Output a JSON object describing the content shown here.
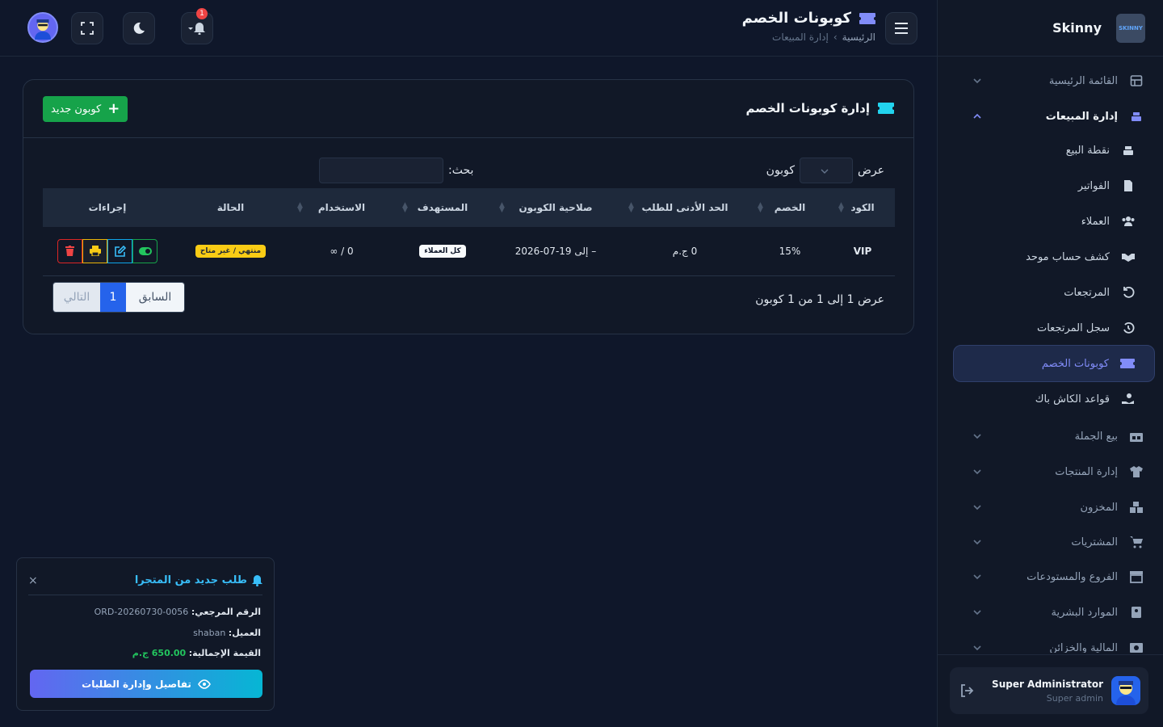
{
  "brand": {
    "name": "Skinny",
    "logo_text": "SKINNY"
  },
  "sidebar": {
    "items": [
      {
        "label": "القائمة الرئيسية",
        "icon": "grid-icon"
      },
      {
        "label": "إدارة المبيعات",
        "icon": "cash-register-icon"
      },
      {
        "label": "نقطة البيع",
        "icon": "cash-register-icon"
      },
      {
        "label": "الفواتير",
        "icon": "invoice-icon"
      },
      {
        "label": "العملاء",
        "icon": "users-icon"
      },
      {
        "label": "كشف حساب موحد",
        "icon": "handshake-icon"
      },
      {
        "label": "المرتجعات",
        "icon": "undo-icon"
      },
      {
        "label": "سجل المرتجعات",
        "icon": "history-icon"
      },
      {
        "label": "كوبونات الخصم",
        "icon": "ticket-icon"
      },
      {
        "label": "قواعد الكاش باك",
        "icon": "hand-coin-icon"
      },
      {
        "label": "بيع الجملة",
        "icon": "warehouse-icon"
      },
      {
        "label": "إدارة المنتجات",
        "icon": "shirt-icon"
      },
      {
        "label": "المخزون",
        "icon": "boxes-icon"
      },
      {
        "label": "المشتريات",
        "icon": "cart-icon"
      },
      {
        "label": "الفروع والمستودعات",
        "icon": "store-icon"
      },
      {
        "label": "الموارد البشرية",
        "icon": "id-badge-icon"
      },
      {
        "label": "المالية والخزائن",
        "icon": "money-icon"
      }
    ],
    "user": {
      "name": "Super Administrator",
      "role": "Super admin"
    }
  },
  "header": {
    "title": "كوبونات الخصم",
    "breadcrumb": {
      "home": "الرئيسية",
      "separator": "›",
      "current": "إدارة المبيعات"
    },
    "notification_count": "1"
  },
  "card": {
    "title": "إدارة كوبونات الخصم",
    "new_button": "كوبون جديد",
    "length_prefix": "عرض",
    "length_suffix": "كوبون",
    "search_label": "بحث:",
    "search_placeholder": ""
  },
  "table": {
    "headers": [
      "الكود",
      "الخصم",
      "الحد الأدنى للطلب",
      "صلاحية الكوبون",
      "المستهدف",
      "الاستخدام",
      "الحالة",
      "إجراءات"
    ],
    "rows": [
      {
        "code": "VIP",
        "discount": "15%",
        "min_order": "0 ج.م",
        "validity": "– إلى 19-07-2026",
        "target": "كل العملاء",
        "usage": "0 / ∞",
        "status": "منتهي / غير متاح"
      }
    ],
    "info": "عرض 1 إلى 1 من 1 كوبون",
    "pager": {
      "prev": "السابق",
      "page": "1",
      "next": "التالي"
    }
  },
  "toast": {
    "title": "طلب جديد من المتجرا",
    "ref_label": "الرقم المرجعي:",
    "ref_value": "ORD-20260730-0056",
    "customer_label": "العميل:",
    "customer_value": "shaban",
    "total_label": "القيمة الإجمالية:",
    "total_value": "650.00 ج.م",
    "button": "تفاصيل وإدارة الطلبات",
    "close": "×"
  },
  "colors": {
    "background": "#0f172a",
    "accent": "#818cf8",
    "success": "#16a34a",
    "info": "#38bdf8",
    "warning": "#facc15",
    "danger": "#ef4444"
  }
}
